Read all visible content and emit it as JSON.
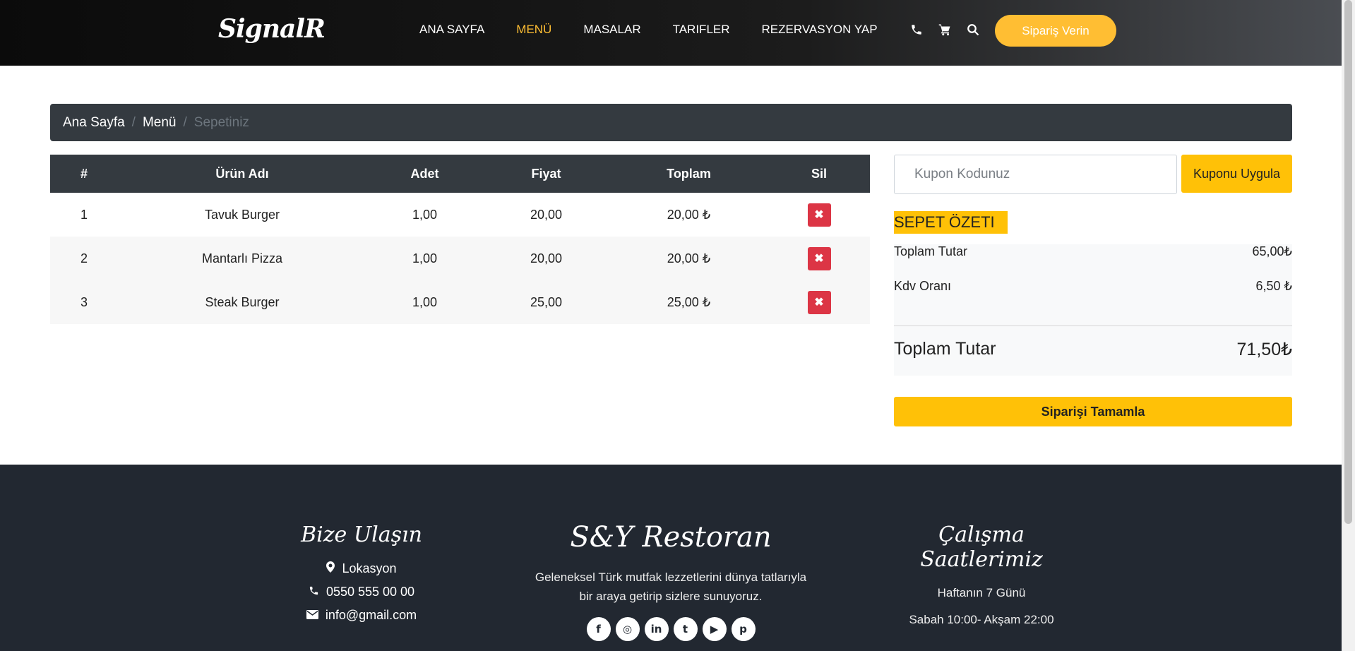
{
  "header": {
    "brand": "SignalR",
    "nav": [
      "ANA SAYFA",
      "MENÜ",
      "MASALAR",
      "TARIFLER",
      "REZERVASYON YAP"
    ],
    "active_nav": "MENÜ",
    "icons": [
      "phone-icon",
      "cart-icon",
      "search-icon"
    ],
    "order_button": "Sipariş Verin"
  },
  "breadcrumb": {
    "home": "Ana Sayfa",
    "menu": "Menü",
    "current": "Sepetiniz"
  },
  "cart": {
    "columns": [
      "#",
      "Ürün Adı",
      "Adet",
      "Fiyat",
      "Toplam",
      "Sil"
    ],
    "rows": [
      {
        "no": "1",
        "name": "Tavuk Burger",
        "qty": "1,00",
        "price": "20,00",
        "total": "20,00 ₺"
      },
      {
        "no": "2",
        "name": "Mantarlı Pizza",
        "qty": "1,00",
        "price": "20,00",
        "total": "20,00 ₺"
      },
      {
        "no": "3",
        "name": "Steak Burger",
        "qty": "1,00",
        "price": "25,00",
        "total": "25,00 ₺"
      }
    ],
    "delete_symbol": "✖"
  },
  "coupon": {
    "placeholder": "Kupon Kodunuz",
    "button": "Kuponu Uygula"
  },
  "summary": {
    "title": "SEPET ÖZETI",
    "subtotal_label": "Toplam Tutar",
    "subtotal_value": "65,00₺",
    "vat_label": "Kdv Oranı",
    "vat_value": "6,50 ₺",
    "total_label": "Toplam Tutar",
    "total_value": "71,50₺",
    "checkout_button": "Siparişi Tamamla"
  },
  "footer": {
    "contact_title": "Bize Ulaşın",
    "location": "Lokasyon",
    "phone": "0550 555 00 00",
    "email": "info@gmail.com",
    "restaurant_name": "S&Y Restoran",
    "description": "Geleneksel Türk mutfak lezzetlerini dünya tatlarıyla bir araya getirip sizlere sunuyoruz.",
    "social_icons": [
      "facebook-icon",
      "instagram-icon",
      "linkedin-icon",
      "twitter-icon",
      "youtube-icon",
      "pinterest-icon"
    ],
    "hours_title": "Çalışma Saatlerimiz",
    "hours_days": "Haftanın 7 Günü",
    "hours_time": "Sabah 10:00- Akşam 22:00"
  },
  "colors": {
    "accent": "#ffbe33",
    "button_yellow": "#ffc107",
    "danger": "#dc3545",
    "dark": "#343a40",
    "footer_bg": "#222831"
  }
}
